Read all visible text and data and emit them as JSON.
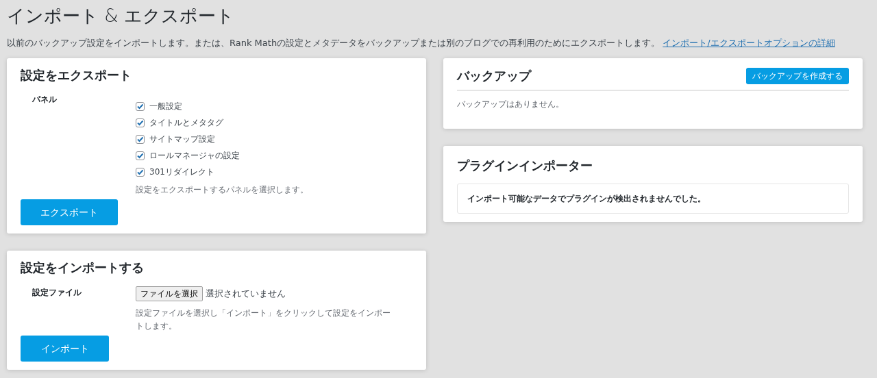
{
  "page": {
    "title": "インポート & エクスポート",
    "description": "以前のバックアップ設定をインポートします。または、Rank Mathの設定とメタデータをバックアップまたは別のブログでの再利用のためにエクスポートします。",
    "link": "インポート/エクスポートオプションの詳細"
  },
  "export": {
    "title": "設定をエクスポート",
    "label": "パネル",
    "panels": [
      {
        "label": "一般設定",
        "checked": true
      },
      {
        "label": "タイトルとメタタグ",
        "checked": true
      },
      {
        "label": "サイトマップ設定",
        "checked": true
      },
      {
        "label": "ロールマネージャの設定",
        "checked": true
      },
      {
        "label": "301リダイレクト",
        "checked": true
      }
    ],
    "help": "設定をエクスポートするパネルを選択します。",
    "button": "エクスポート"
  },
  "import": {
    "title": "設定をインポートする",
    "label": "設定ファイル",
    "file_button": "ファイルを選択",
    "file_status": "選択されていません",
    "help": "設定ファイルを選択し「インポート」をクリックして設定をインポートします。",
    "button": "インポート"
  },
  "backup": {
    "title": "バックアップ",
    "button": "バックアップを作成する",
    "empty": "バックアップはありません。"
  },
  "importer": {
    "title": "プラグインインポーター",
    "message": "インポート可能なデータでプラグインが検出されませんでした。"
  }
}
